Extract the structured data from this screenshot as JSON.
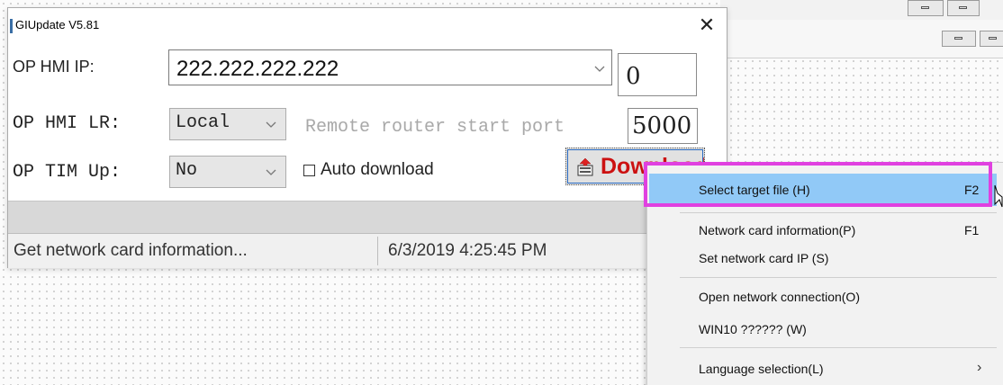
{
  "window": {
    "title": "GIUpdate V5.81",
    "close_glyph": "✕"
  },
  "form": {
    "hmi_ip_label": "OP HMI IP:",
    "hmi_ip_value": "222.222.222.222",
    "hmi_ip_side_value": "0",
    "lr_label": "OP HMI LR:",
    "lr_value": "Local",
    "remote_port_label": "Remote router start port",
    "remote_port_value": "5000",
    "tim_label": "OP TIM Up:",
    "tim_value": "No",
    "auto_download_label": "Auto download",
    "auto_download_checked": false,
    "download_button_label": "Download"
  },
  "status_bar": {
    "message": "Get network card information...",
    "datetime": "6/3/2019  4:25:45 PM"
  },
  "context_menu": {
    "items": [
      {
        "label": "Select target file (H)",
        "shortcut": "F2",
        "selected": true
      },
      {
        "label": "Network card information(P)",
        "shortcut": "F1"
      },
      {
        "label": "Set network card IP (S)",
        "shortcut": ""
      },
      {
        "label": "Open network connection(O)",
        "shortcut": ""
      },
      {
        "label": "WIN10 ?????? (W)",
        "shortcut": ""
      },
      {
        "label": "Language selection(L)",
        "shortcut": "",
        "submenu": true
      }
    ]
  },
  "colors": {
    "highlight_border": "#e040e0",
    "selected_item": "#91c9f7",
    "download_text": "#cc1111"
  },
  "icons": {
    "close": "close-icon",
    "dropdown": "chevron-down-icon",
    "download": "download-icon",
    "submenu": "chevron-right-icon",
    "cursor": "mouse-cursor-icon"
  }
}
